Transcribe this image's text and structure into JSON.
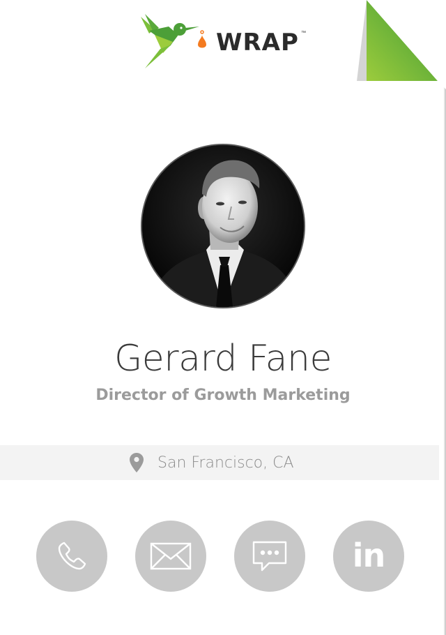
{
  "brand": {
    "wordmark": "WRAP",
    "trademark": "™",
    "colors": {
      "green_light": "#9ccc3c",
      "green_dark": "#4c9f38",
      "orange": "#f47b20"
    }
  },
  "profile": {
    "name": "Gerard Fane",
    "title": "Director of Growth Marketing",
    "location": "San Francisco, CA",
    "photo_icon": "profile-photo"
  },
  "contact_actions": [
    {
      "icon": "phone-icon"
    },
    {
      "icon": "email-icon"
    },
    {
      "icon": "sms-icon"
    },
    {
      "icon": "linkedin-icon",
      "label": "in"
    }
  ],
  "colors": {
    "button_gray": "#c8c8c8",
    "location_bar": "#f3f3f3",
    "name_text": "#3a3a3a",
    "title_text": "#9b9b9b"
  }
}
